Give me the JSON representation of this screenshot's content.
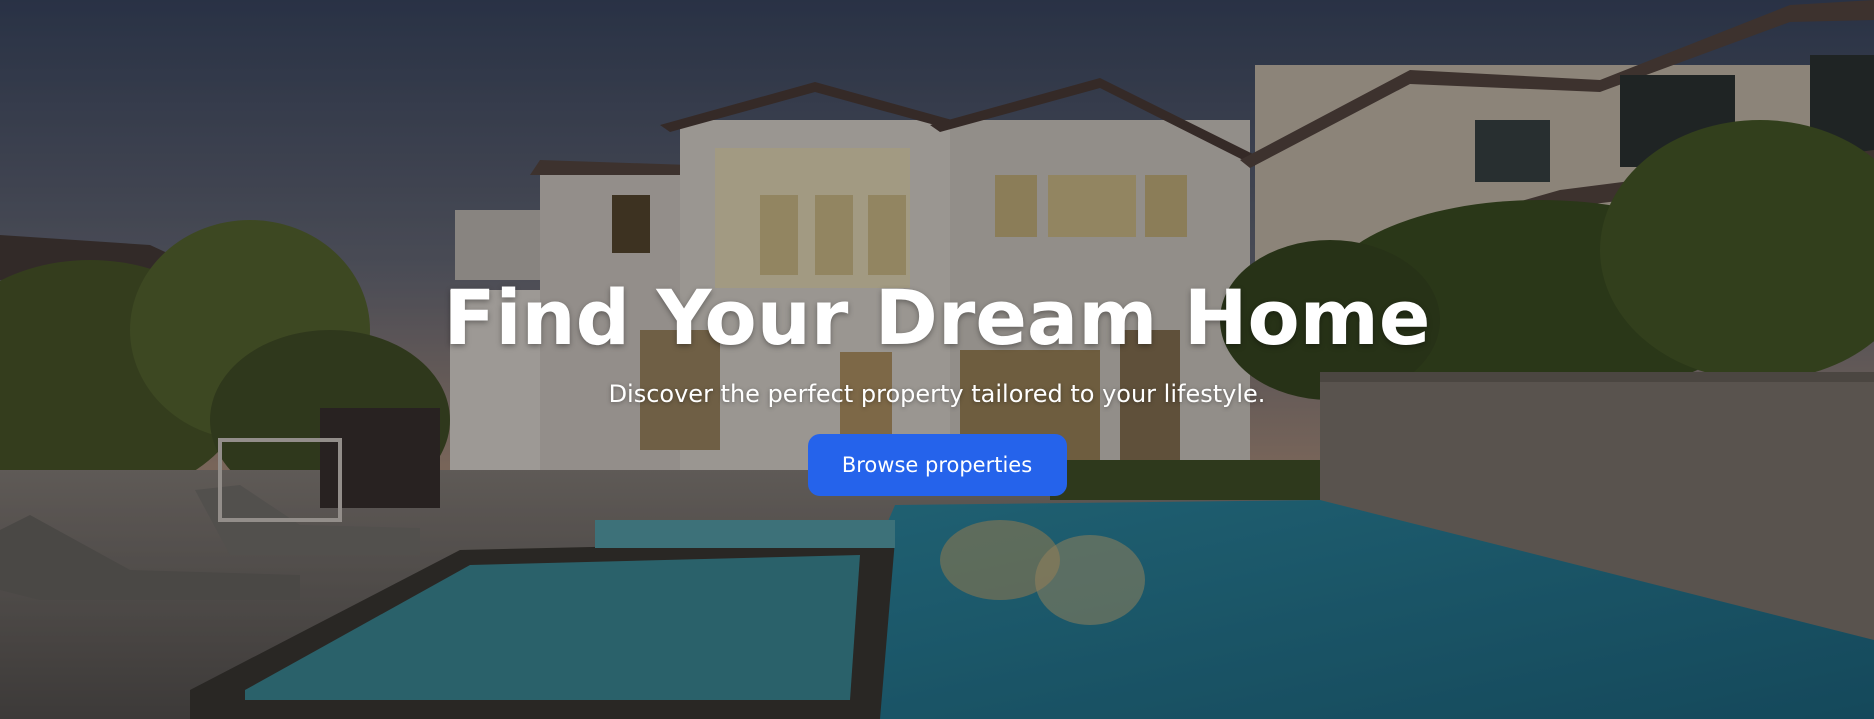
{
  "hero": {
    "title": "Find Your Dream Home",
    "subtitle": "Discover the perfect property tailored to your lifestyle.",
    "cta_label": "Browse properties",
    "background_image": "luxury-house-with-pool-at-dusk"
  },
  "colors": {
    "accent": "#2563eb",
    "text": "#ffffff",
    "sky": "#3c4a66",
    "pool": "#2b8fa3"
  }
}
